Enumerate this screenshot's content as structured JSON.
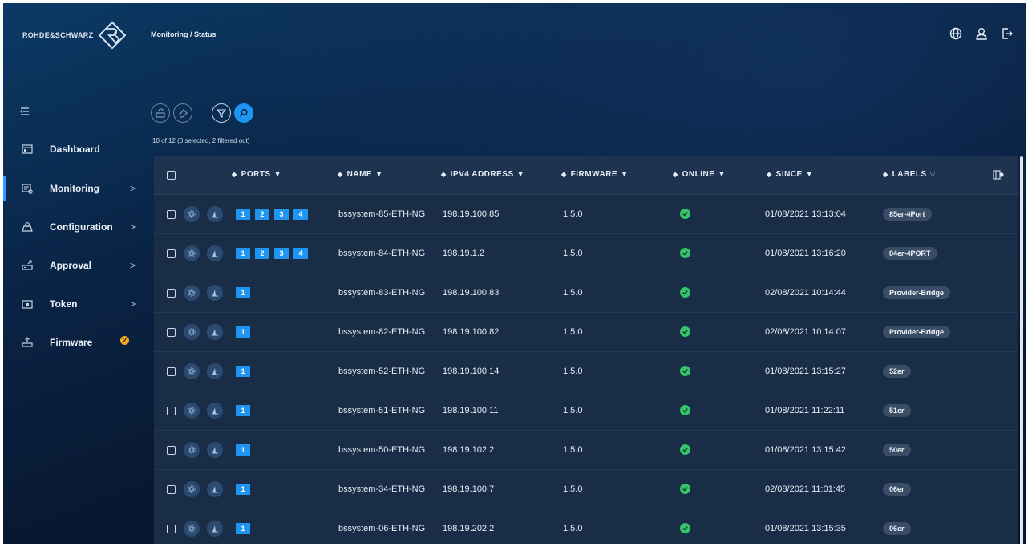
{
  "brand": {
    "name": "ROHDE&SCHWARZ"
  },
  "breadcrumb": "Monitoring / Status",
  "topbar": {
    "icons": [
      "globe-icon",
      "user-icon",
      "logout-icon"
    ]
  },
  "sidebar": {
    "items": [
      {
        "label": "Dashboard",
        "icon": "dashboard-icon",
        "chevron": ""
      },
      {
        "label": "Monitoring",
        "icon": "monitoring-icon",
        "chevron": ">",
        "active": true
      },
      {
        "label": "Configuration",
        "icon": "configuration-icon",
        "chevron": ">"
      },
      {
        "label": "Approval",
        "icon": "approval-icon",
        "chevron": ">"
      },
      {
        "label": "Token",
        "icon": "token-icon",
        "chevron": ">"
      },
      {
        "label": "Firmware",
        "icon": "firmware-icon",
        "chevron": "",
        "badge": "2"
      }
    ]
  },
  "toolbar": {
    "count_text": "10 of 12 (0 selected, 2 filtered out)"
  },
  "table": {
    "columns": {
      "ports": "PORTS",
      "name": "NAME",
      "ipv4": "IPV4 ADDRESS",
      "firmware": "FIRMWARE",
      "online": "ONLINE",
      "since": "SINCE",
      "labels": "LABELS"
    },
    "rows": [
      {
        "ports": [
          "1",
          "2",
          "3",
          "4"
        ],
        "name": "bssystem-85-ETH-NG",
        "ipv4": "198.19.100.85",
        "firmware": "1.5.0",
        "since": "01/08/2021 13:13:04",
        "label": "85er-4Port"
      },
      {
        "ports": [
          "1",
          "2",
          "3",
          "4"
        ],
        "name": "bssystem-84-ETH-NG",
        "ipv4": "198.19.1.2",
        "firmware": "1.5.0",
        "since": "01/08/2021 13:16:20",
        "label": "84er-4PORT"
      },
      {
        "ports": [
          "1"
        ],
        "name": "bssystem-83-ETH-NG",
        "ipv4": "198.19.100.83",
        "firmware": "1.5.0",
        "since": "02/08/2021 10:14:44",
        "label": "Provider-Bridge"
      },
      {
        "ports": [
          "1"
        ],
        "name": "bssystem-82-ETH-NG",
        "ipv4": "198.19.100.82",
        "firmware": "1.5.0",
        "since": "02/08/2021 10:14:07",
        "label": "Provider-Bridge"
      },
      {
        "ports": [
          "1"
        ],
        "name": "bssystem-52-ETH-NG",
        "ipv4": "198.19.100.14",
        "firmware": "1.5.0",
        "since": "01/08/2021 13:15:27",
        "label": "52er"
      },
      {
        "ports": [
          "1"
        ],
        "name": "bssystem-51-ETH-NG",
        "ipv4": "198.19.100.11",
        "firmware": "1.5.0",
        "since": "01/08/2021 11:22:11",
        "label": "51er"
      },
      {
        "ports": [
          "1"
        ],
        "name": "bssystem-50-ETH-NG",
        "ipv4": "198.19.102.2",
        "firmware": "1.5.0",
        "since": "01/08/2021 13:15:42",
        "label": "50er"
      },
      {
        "ports": [
          "1"
        ],
        "name": "bssystem-34-ETH-NG",
        "ipv4": "198.19.100.7",
        "firmware": "1.5.0",
        "since": "02/08/2021 11:01:45",
        "label": "06er"
      },
      {
        "ports": [
          "1"
        ],
        "name": "bssystem-06-ETH-NG",
        "ipv4": "198.19.202.2",
        "firmware": "1.5.0",
        "since": "01/08/2021 13:15:35",
        "label": "06er"
      }
    ]
  },
  "colors": {
    "accent": "#1e95f2",
    "online": "#36c46b",
    "badge": "#f5a623"
  }
}
